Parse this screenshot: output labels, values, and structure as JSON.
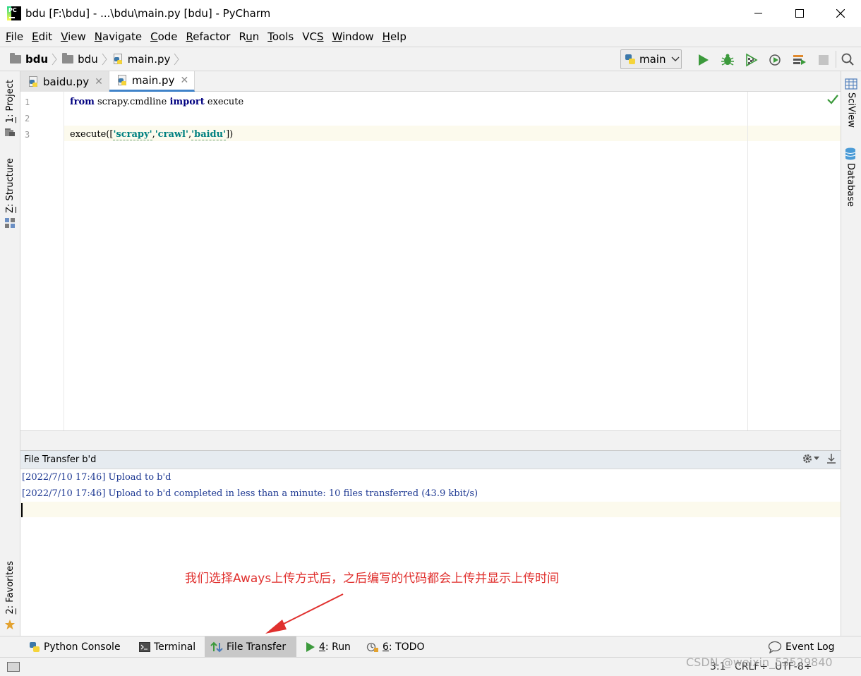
{
  "window": {
    "title": "bdu [F:\\bdu] - ...\\bdu\\main.py [bdu] - PyCharm",
    "logo_text": "PC"
  },
  "menu": {
    "items": [
      {
        "pre": "",
        "mn": "F",
        "post": "ile"
      },
      {
        "pre": "",
        "mn": "E",
        "post": "dit"
      },
      {
        "pre": "",
        "mn": "V",
        "post": "iew"
      },
      {
        "pre": "",
        "mn": "N",
        "post": "avigate"
      },
      {
        "pre": "",
        "mn": "C",
        "post": "ode"
      },
      {
        "pre": "",
        "mn": "R",
        "post": "efactor"
      },
      {
        "pre": "R",
        "mn": "u",
        "post": "n"
      },
      {
        "pre": "",
        "mn": "T",
        "post": "ools"
      },
      {
        "pre": "VC",
        "mn": "S",
        "post": ""
      },
      {
        "pre": "",
        "mn": "W",
        "post": "indow"
      },
      {
        "pre": "",
        "mn": "H",
        "post": "elp"
      }
    ]
  },
  "breadcrumb": {
    "project": "bdu",
    "folder": "bdu",
    "file": "main.py"
  },
  "run_config": {
    "name": "main"
  },
  "left_tabs": {
    "project": {
      "mn": "1",
      "label": ": Project"
    },
    "structure": {
      "mn": "Z",
      "label": ": Structure"
    },
    "favorites": {
      "mn": "2",
      "label": ": Favorites"
    }
  },
  "right_tabs": {
    "sciview": "SciView",
    "database": "Database"
  },
  "editor_tabs": [
    {
      "label": "baidu.py",
      "active": false
    },
    {
      "label": "main.py",
      "active": true
    }
  ],
  "editor": {
    "line_numbers": [
      "1",
      "2",
      "3"
    ],
    "line1": {
      "kw1": "from",
      "mid": " scrapy.cmdline ",
      "kw2": "import",
      "end": " execute"
    },
    "line3": {
      "pre": "execute([",
      "s1": "'scrapy'",
      "c1": ",",
      "s2": "'crawl'",
      "c2": ",",
      "s3": "'baidu'",
      "post": "])"
    }
  },
  "tool_window": {
    "title": "File Transfer b'd",
    "log": [
      "[2022/7/10 17:46] Upload to b'd",
      "[2022/7/10 17:46] Upload to b'd completed in less than a minute: 10 files transferred (43.9 kbit/s)"
    ],
    "annotation": "我们选择Aways上传方式后，之后编写的代码都会上传并显示上传时间"
  },
  "bottom_tabs": {
    "python_console": "Python Console",
    "terminal": "Terminal",
    "file_transfer": "File Transfer",
    "run": {
      "mn": "4",
      "label": ": Run"
    },
    "todo": {
      "mn": "6",
      "label": ": TODO"
    },
    "event_log": "Event Log"
  },
  "status": {
    "position": "3:1",
    "line_sep": "CRLF",
    "encoding": "UTF-8"
  },
  "watermark": "CSDN @weixin_53529840",
  "colors": {
    "keyword": "#000080",
    "string": "#008080",
    "log_text": "#1f3a93",
    "annotation": "#e0302e",
    "active_tab_underline": "#4083c9",
    "run_green": "#3c9a3c"
  }
}
